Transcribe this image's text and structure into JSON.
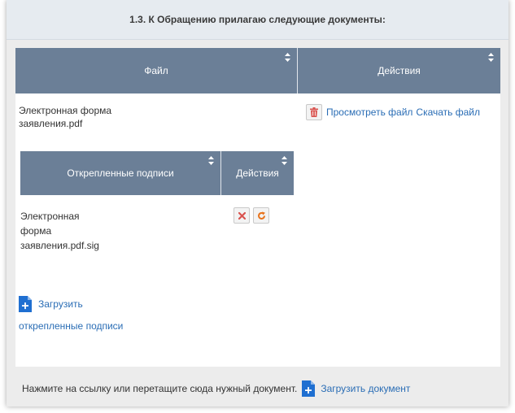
{
  "section": {
    "title": "1.3. К Обращению прилагаю следующие документы:"
  },
  "files_table": {
    "columns": [
      "Файл",
      "Действия"
    ],
    "rows": [
      {
        "file_name": "Электронная форма заявления.pdf",
        "actions": {
          "view": "Просмотреть файл",
          "download": "Скачать файл"
        }
      }
    ]
  },
  "signatures_table": {
    "columns": [
      "Открепленные подписи",
      "Действия"
    ],
    "rows": [
      {
        "file_name": "Электронная форма заявления.pdf.sig"
      }
    ],
    "upload_label_line1": "Загрузить",
    "upload_label_line2": "открепленные подписи"
  },
  "footer": {
    "hint": "Нажмите на ссылку или перетащите сюда нужный документ.",
    "upload_link": "Загрузить документ"
  },
  "colors": {
    "header_bg": "#6b7f97",
    "link": "#2a6db5",
    "delete_red": "#d9534f",
    "refresh_orange": "#e8731c",
    "upload_blue": "#1f6fd1"
  }
}
